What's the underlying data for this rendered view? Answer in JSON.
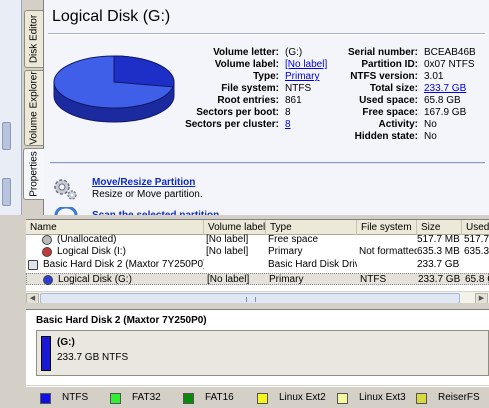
{
  "tabs": [
    "Disk Editor",
    "Volume Explorer",
    "Properties"
  ],
  "title": "Logical Disk (G:)",
  "props_left": [
    {
      "label": "Volume letter:",
      "value": "(G:)",
      "link": false
    },
    {
      "label": "Volume label:",
      "value": "[No label]",
      "link": true
    },
    {
      "label": "Type:",
      "value": "Primary",
      "link": true
    },
    {
      "label": "File system:",
      "value": "NTFS",
      "link": false
    },
    {
      "label": "Root entries:",
      "value": "861",
      "link": false
    },
    {
      "label": "Sectors per boot:",
      "value": "8",
      "link": false
    },
    {
      "label": "Sectors per cluster:",
      "value": "8",
      "link": true
    }
  ],
  "props_right": [
    {
      "label": "Serial number:",
      "value": "BCEAB46B",
      "link": false
    },
    {
      "label": "Partition ID:",
      "value": "0x07 NTFS",
      "link": false
    },
    {
      "label": "NTFS version:",
      "value": "3.01",
      "link": false
    },
    {
      "label": "Total size:",
      "value": "233.7 GB",
      "link": true
    },
    {
      "label": "Used space:",
      "value": "65.8 GB",
      "link": false
    },
    {
      "label": "Free space:",
      "value": "167.9 GB",
      "link": false
    },
    {
      "label": "Activity:",
      "value": "No",
      "link": false
    },
    {
      "label": "Hidden state:",
      "value": "No",
      "link": false
    }
  ],
  "pie": {
    "used_fraction": 0.28,
    "used_color": "#1e2fc8",
    "free_color": "#3f5fe8"
  },
  "tasks": [
    {
      "title": "Move/Resize Partition",
      "desc": "Resize or Move partition."
    },
    {
      "title": "Scan the selected partition",
      "desc": ""
    }
  ],
  "list": {
    "columns": [
      "Name",
      "Volume label",
      "Type",
      "File system",
      "Size",
      "Used"
    ],
    "rows": [
      {
        "name": "(Unallocated)",
        "label": "[No label]",
        "type": "Free space",
        "fs": "",
        "size": "517.7 MB",
        "used": "517.7",
        "icon": "unallocated-icon"
      },
      {
        "name": "Logical Disk (I:)",
        "label": "[No label]",
        "type": "Primary",
        "fs": "Not formatted",
        "size": "635.3 MB",
        "used": "635.3",
        "icon": "disk-red-icon"
      },
      {
        "name": "Basic Hard Disk 2 (Maxtor 7Y250P0)",
        "label": "",
        "type": "Basic Hard Disk Drive",
        "fs": "",
        "size": "233.7 GB",
        "used": "",
        "icon": "hard-disk-icon"
      },
      {
        "name": "Logical Disk (G:)",
        "label": "[No label]",
        "type": "Primary",
        "fs": "NTFS",
        "size": "233.7 GB",
        "used": "65.8 G",
        "icon": "disk-blue-icon"
      }
    ]
  },
  "diskmap": {
    "title": "Basic Hard Disk 2 (Maxtor 7Y250P0)",
    "segment_name": "(G:)",
    "segment_size": "233.7 GB NTFS",
    "segment_color": "#1a1ad6"
  },
  "legend": [
    {
      "label": "NTFS",
      "color": "#1010e0"
    },
    {
      "label": "FAT32",
      "color": "#33ee33"
    },
    {
      "label": "FAT16",
      "color": "#0a8a0a"
    },
    {
      "label": "Linux Ext2",
      "color": "#f5f520"
    },
    {
      "label": "Linux Ext3",
      "color": "#f7f7a0"
    },
    {
      "label": "ReiserFS",
      "color": "#d8d840"
    }
  ]
}
